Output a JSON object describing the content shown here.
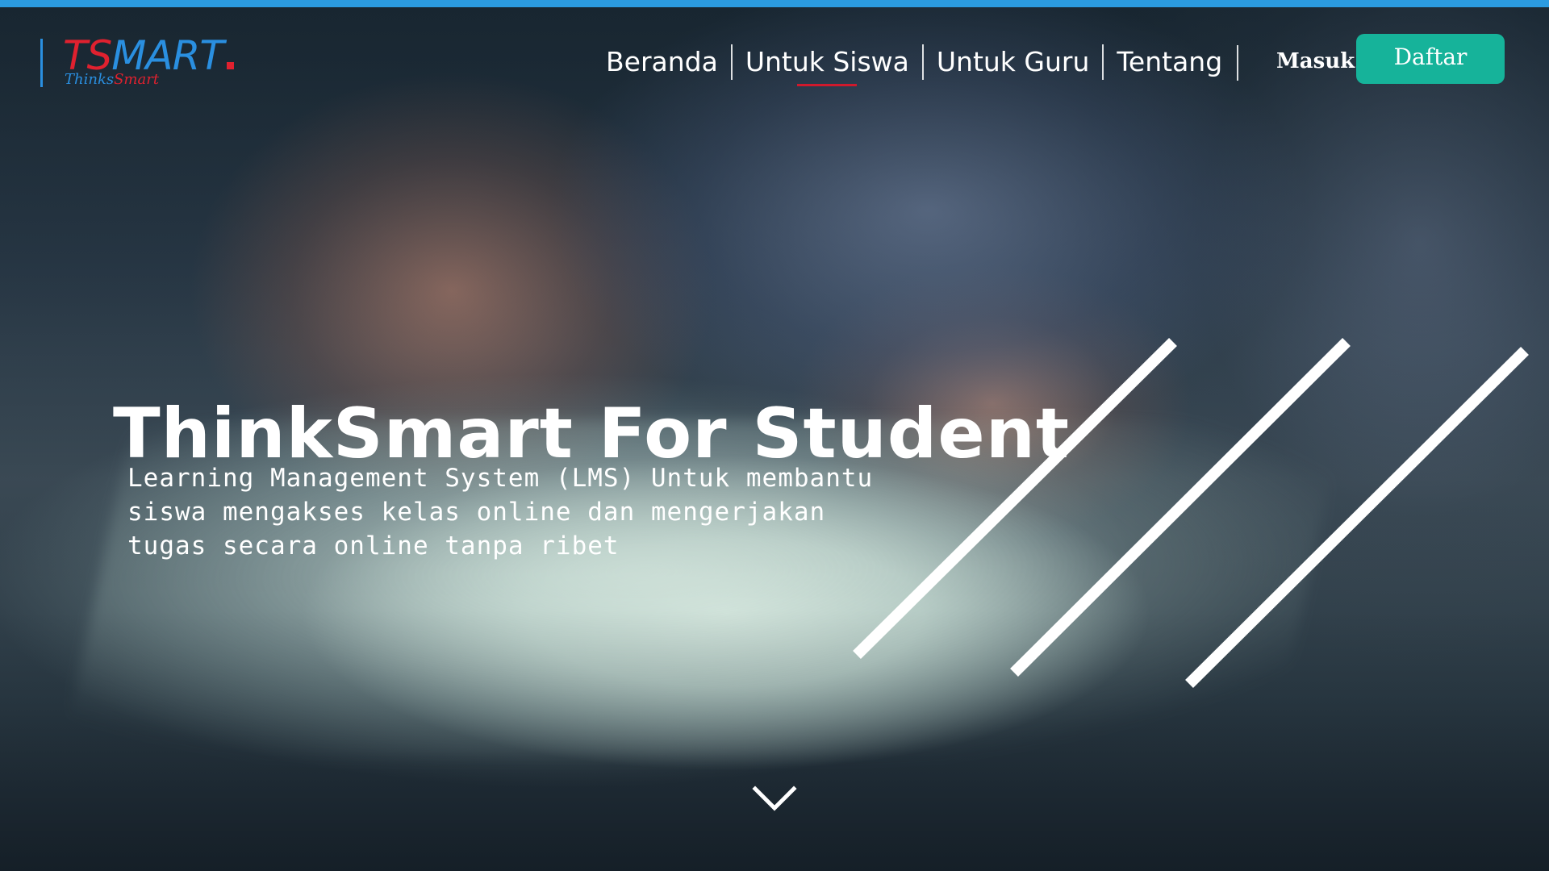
{
  "colors": {
    "top_bar": "#2b9be0",
    "logo_ts": "#e0212f",
    "logo_mart": "#2a8fe0",
    "logo_sub_thinks": "#2a8fe0",
    "logo_sub_smart": "#e0212f",
    "logo_rule": "#2a8fe0",
    "nav_active_underline": "#d0192c",
    "signup_bg": "#16b39a",
    "stripe": "#ffffff"
  },
  "logo": {
    "ts": "TS",
    "mart": "MART",
    "sub_thinks": "Thinks",
    "sub_smart": "Smart"
  },
  "nav": {
    "items": [
      {
        "label": "Beranda",
        "active": false
      },
      {
        "label": "Untuk Siswa",
        "active": true
      },
      {
        "label": "Untuk Guru",
        "active": false
      },
      {
        "label": "Tentang",
        "active": false
      }
    ],
    "login_label": "Masuk",
    "signup_label": "Daftar"
  },
  "hero": {
    "title": "ThinkSmart For Student",
    "description_lines": [
      "Learning Management System (LMS) Untuk membantu",
      "siswa mengakses kelas online dan mengerjakan",
      "tugas secara online tanpa ribet"
    ]
  },
  "icons": {
    "scroll_down": "chevron-down-icon",
    "decor": "diagonal-stripes"
  }
}
